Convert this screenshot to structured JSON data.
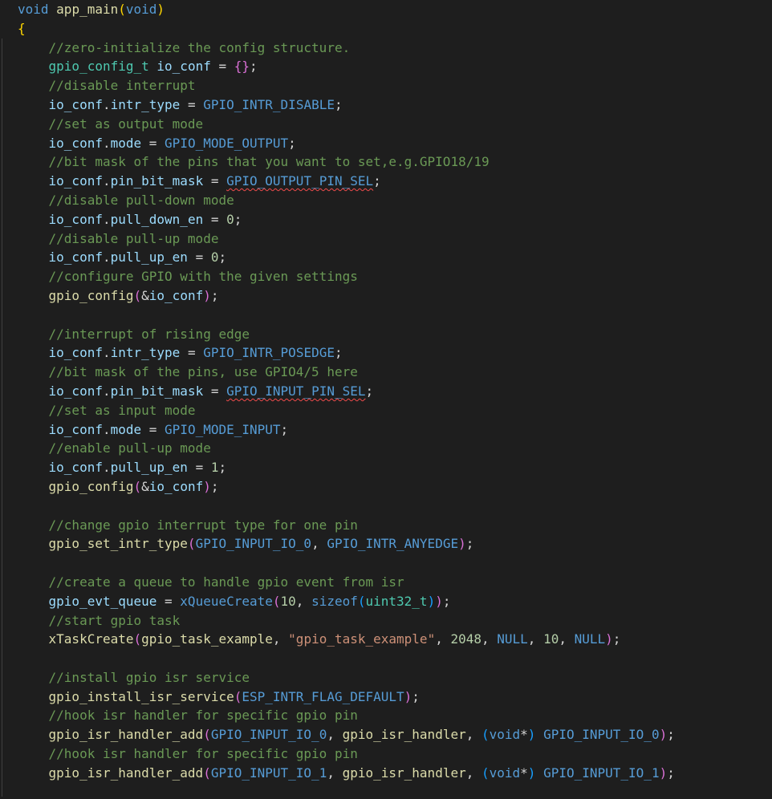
{
  "editor": {
    "lines": [
      [
        {
          "t": "void",
          "c": "kw"
        },
        {
          "t": " "
        },
        {
          "t": "app_main",
          "c": "fn"
        },
        {
          "t": "(",
          "c": "p1"
        },
        {
          "t": "void",
          "c": "kw"
        },
        {
          "t": ")",
          "c": "p1"
        }
      ],
      [
        {
          "t": "{",
          "c": "p1"
        }
      ],
      [
        {
          "t": "    "
        },
        {
          "t": "//zero-initialize the config structure.",
          "c": "cm"
        }
      ],
      [
        {
          "t": "    "
        },
        {
          "t": "gpio_config_t",
          "c": "typ"
        },
        {
          "t": " "
        },
        {
          "t": "io_conf",
          "c": "var"
        },
        {
          "t": " = "
        },
        {
          "t": "{}",
          "c": "p2"
        },
        {
          "t": ";"
        }
      ],
      [
        {
          "t": "    "
        },
        {
          "t": "//disable interrupt",
          "c": "cm"
        }
      ],
      [
        {
          "t": "    "
        },
        {
          "t": "io_conf",
          "c": "var"
        },
        {
          "t": "."
        },
        {
          "t": "intr_type",
          "c": "var"
        },
        {
          "t": " = "
        },
        {
          "t": "GPIO_INTR_DISABLE",
          "c": "mac"
        },
        {
          "t": ";"
        }
      ],
      [
        {
          "t": "    "
        },
        {
          "t": "//set as output mode",
          "c": "cm"
        }
      ],
      [
        {
          "t": "    "
        },
        {
          "t": "io_conf",
          "c": "var"
        },
        {
          "t": "."
        },
        {
          "t": "mode",
          "c": "var"
        },
        {
          "t": " = "
        },
        {
          "t": "GPIO_MODE_OUTPUT",
          "c": "mac"
        },
        {
          "t": ";"
        }
      ],
      [
        {
          "t": "    "
        },
        {
          "t": "//bit mask of the pins that you want to set,e.g.GPIO18/19",
          "c": "cm"
        }
      ],
      [
        {
          "t": "    "
        },
        {
          "t": "io_conf",
          "c": "var"
        },
        {
          "t": "."
        },
        {
          "t": "pin_bit_mask",
          "c": "var"
        },
        {
          "t": " = "
        },
        {
          "t": "GPIO_OUTPUT_PIN_SEL",
          "c": "mac",
          "sq": true
        },
        {
          "t": ";"
        }
      ],
      [
        {
          "t": "    "
        },
        {
          "t": "//disable pull-down mode",
          "c": "cm"
        }
      ],
      [
        {
          "t": "    "
        },
        {
          "t": "io_conf",
          "c": "var"
        },
        {
          "t": "."
        },
        {
          "t": "pull_down_en",
          "c": "var"
        },
        {
          "t": " = "
        },
        {
          "t": "0",
          "c": "num"
        },
        {
          "t": ";"
        }
      ],
      [
        {
          "t": "    "
        },
        {
          "t": "//disable pull-up mode",
          "c": "cm"
        }
      ],
      [
        {
          "t": "    "
        },
        {
          "t": "io_conf",
          "c": "var"
        },
        {
          "t": "."
        },
        {
          "t": "pull_up_en",
          "c": "var"
        },
        {
          "t": " = "
        },
        {
          "t": "0",
          "c": "num"
        },
        {
          "t": ";"
        }
      ],
      [
        {
          "t": "    "
        },
        {
          "t": "//configure GPIO with the given settings",
          "c": "cm"
        }
      ],
      [
        {
          "t": "    "
        },
        {
          "t": "gpio_config",
          "c": "fn"
        },
        {
          "t": "(",
          "c": "p2"
        },
        {
          "t": "&"
        },
        {
          "t": "io_conf",
          "c": "var"
        },
        {
          "t": ")",
          "c": "p2"
        },
        {
          "t": ";"
        }
      ],
      [],
      [
        {
          "t": "    "
        },
        {
          "t": "//interrupt of rising edge",
          "c": "cm"
        }
      ],
      [
        {
          "t": "    "
        },
        {
          "t": "io_conf",
          "c": "var"
        },
        {
          "t": "."
        },
        {
          "t": "intr_type",
          "c": "var"
        },
        {
          "t": " = "
        },
        {
          "t": "GPIO_INTR_POSEDGE",
          "c": "mac"
        },
        {
          "t": ";"
        }
      ],
      [
        {
          "t": "    "
        },
        {
          "t": "//bit mask of the pins, use GPIO4/5 here",
          "c": "cm"
        }
      ],
      [
        {
          "t": "    "
        },
        {
          "t": "io_conf",
          "c": "var"
        },
        {
          "t": "."
        },
        {
          "t": "pin_bit_mask",
          "c": "var"
        },
        {
          "t": " = "
        },
        {
          "t": "GPIO_INPUT_PIN_SEL",
          "c": "mac",
          "sq": true
        },
        {
          "t": ";"
        }
      ],
      [
        {
          "t": "    "
        },
        {
          "t": "//set as input mode",
          "c": "cm"
        }
      ],
      [
        {
          "t": "    "
        },
        {
          "t": "io_conf",
          "c": "var"
        },
        {
          "t": "."
        },
        {
          "t": "mode",
          "c": "var"
        },
        {
          "t": " = "
        },
        {
          "t": "GPIO_MODE_INPUT",
          "c": "mac"
        },
        {
          "t": ";"
        }
      ],
      [
        {
          "t": "    "
        },
        {
          "t": "//enable pull-up mode",
          "c": "cm"
        }
      ],
      [
        {
          "t": "    "
        },
        {
          "t": "io_conf",
          "c": "var"
        },
        {
          "t": "."
        },
        {
          "t": "pull_up_en",
          "c": "var"
        },
        {
          "t": " = "
        },
        {
          "t": "1",
          "c": "num"
        },
        {
          "t": ";"
        }
      ],
      [
        {
          "t": "    "
        },
        {
          "t": "gpio_config",
          "c": "fn"
        },
        {
          "t": "(",
          "c": "p2"
        },
        {
          "t": "&"
        },
        {
          "t": "io_conf",
          "c": "var"
        },
        {
          "t": ")",
          "c": "p2"
        },
        {
          "t": ";"
        }
      ],
      [],
      [
        {
          "t": "    "
        },
        {
          "t": "//change gpio interrupt type for one pin",
          "c": "cm"
        }
      ],
      [
        {
          "t": "    "
        },
        {
          "t": "gpio_set_intr_type",
          "c": "fn"
        },
        {
          "t": "(",
          "c": "p2"
        },
        {
          "t": "GPIO_INPUT_IO_0",
          "c": "mac"
        },
        {
          "t": ", "
        },
        {
          "t": "GPIO_INTR_ANYEDGE",
          "c": "mac"
        },
        {
          "t": ")",
          "c": "p2"
        },
        {
          "t": ";"
        }
      ],
      [],
      [
        {
          "t": "    "
        },
        {
          "t": "//create a queue to handle gpio event from isr",
          "c": "cm"
        }
      ],
      [
        {
          "t": "    "
        },
        {
          "t": "gpio_evt_queue",
          "c": "var"
        },
        {
          "t": " = "
        },
        {
          "t": "xQueueCreate",
          "c": "mac"
        },
        {
          "t": "(",
          "c": "p2"
        },
        {
          "t": "10",
          "c": "num"
        },
        {
          "t": ", "
        },
        {
          "t": "sizeof",
          "c": "kw"
        },
        {
          "t": "(",
          "c": "p3"
        },
        {
          "t": "uint32_t",
          "c": "typ"
        },
        {
          "t": ")",
          "c": "p3"
        },
        {
          "t": ")",
          "c": "p2"
        },
        {
          "t": ";"
        }
      ],
      [
        {
          "t": "    "
        },
        {
          "t": "//start gpio task",
          "c": "cm"
        }
      ],
      [
        {
          "t": "    "
        },
        {
          "t": "xTaskCreate",
          "c": "fn"
        },
        {
          "t": "(",
          "c": "p2"
        },
        {
          "t": "gpio_task_example",
          "c": "fn"
        },
        {
          "t": ", "
        },
        {
          "t": "\"gpio_task_example\"",
          "c": "str"
        },
        {
          "t": ", "
        },
        {
          "t": "2048",
          "c": "num"
        },
        {
          "t": ", "
        },
        {
          "t": "NULL",
          "c": "mac"
        },
        {
          "t": ", "
        },
        {
          "t": "10",
          "c": "num"
        },
        {
          "t": ", "
        },
        {
          "t": "NULL",
          "c": "mac"
        },
        {
          "t": ")",
          "c": "p2"
        },
        {
          "t": ";"
        }
      ],
      [],
      [
        {
          "t": "    "
        },
        {
          "t": "//install gpio isr service",
          "c": "cm"
        }
      ],
      [
        {
          "t": "    "
        },
        {
          "t": "gpio_install_isr_service",
          "c": "fn"
        },
        {
          "t": "(",
          "c": "p2"
        },
        {
          "t": "ESP_INTR_FLAG_DEFAULT",
          "c": "mac"
        },
        {
          "t": ")",
          "c": "p2"
        },
        {
          "t": ";"
        }
      ],
      [
        {
          "t": "    "
        },
        {
          "t": "//hook isr handler for specific gpio pin",
          "c": "cm"
        }
      ],
      [
        {
          "t": "    "
        },
        {
          "t": "gpio_isr_handler_add",
          "c": "fn"
        },
        {
          "t": "(",
          "c": "p2"
        },
        {
          "t": "GPIO_INPUT_IO_0",
          "c": "mac"
        },
        {
          "t": ", "
        },
        {
          "t": "gpio_isr_handler",
          "c": "fn"
        },
        {
          "t": ", "
        },
        {
          "t": "(",
          "c": "p3"
        },
        {
          "t": "void",
          "c": "kw"
        },
        {
          "t": "*",
          "c": "op"
        },
        {
          "t": ")",
          "c": "p3"
        },
        {
          "t": " "
        },
        {
          "t": "GPIO_INPUT_IO_0",
          "c": "mac"
        },
        {
          "t": ")",
          "c": "p2"
        },
        {
          "t": ";"
        }
      ],
      [
        {
          "t": "    "
        },
        {
          "t": "//hook isr handler for specific gpio pin",
          "c": "cm"
        }
      ],
      [
        {
          "t": "    "
        },
        {
          "t": "gpio_isr_handler_add",
          "c": "fn"
        },
        {
          "t": "(",
          "c": "p2"
        },
        {
          "t": "GPIO_INPUT_IO_1",
          "c": "mac"
        },
        {
          "t": ", "
        },
        {
          "t": "gpio_isr_handler",
          "c": "fn"
        },
        {
          "t": ", "
        },
        {
          "t": "(",
          "c": "p3"
        },
        {
          "t": "void",
          "c": "kw"
        },
        {
          "t": "*",
          "c": "op"
        },
        {
          "t": ")",
          "c": "p3"
        },
        {
          "t": " "
        },
        {
          "t": "GPIO_INPUT_IO_1",
          "c": "mac"
        },
        {
          "t": ")",
          "c": "p2"
        },
        {
          "t": ";"
        }
      ]
    ]
  }
}
